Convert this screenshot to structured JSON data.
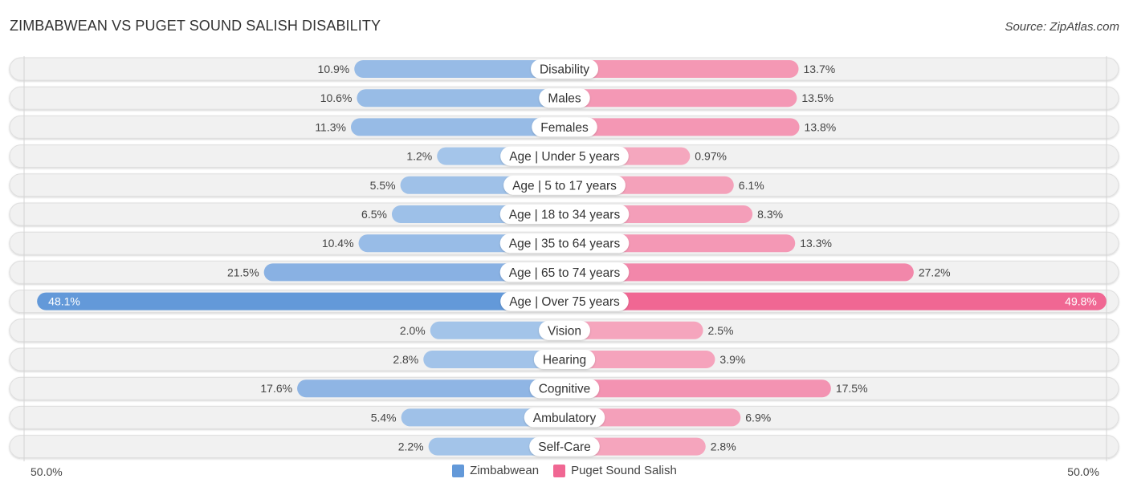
{
  "header": {
    "title": "ZIMBABWEAN VS PUGET SOUND SALISH DISABILITY",
    "source": "Source: ZipAtlas.com"
  },
  "colors": {
    "left_light": "#a6c6ea",
    "left_strong": "#6399d9",
    "right_light": "#f5a8bf",
    "right_strong": "#f06793",
    "track": "#f1f1f1"
  },
  "axis": {
    "left_label": "50.0%",
    "right_label": "50.0%"
  },
  "legend": [
    {
      "label": "Zimbabwean",
      "color": "#6399d9"
    },
    {
      "label": "Puget Sound Salish",
      "color": "#f06793"
    }
  ],
  "chart_data": {
    "type": "bar",
    "orientation": "horizontal-diverging",
    "title": "ZIMBABWEAN VS PUGET SOUND SALISH DISABILITY",
    "xlim": [
      -50,
      50
    ],
    "x_tick_labels": [
      "50.0%",
      "50.0%"
    ],
    "legend_position": "bottom-center",
    "categories": [
      "Disability",
      "Males",
      "Females",
      "Age | Under 5 years",
      "Age | 5 to 17 years",
      "Age | 18 to 34 years",
      "Age | 35 to 64 years",
      "Age | 65 to 74 years",
      "Age | Over 75 years",
      "Vision",
      "Hearing",
      "Cognitive",
      "Ambulatory",
      "Self-Care"
    ],
    "series": [
      {
        "name": "Zimbabwean",
        "side": "left",
        "values": [
          10.9,
          10.6,
          11.3,
          1.2,
          5.5,
          6.5,
          10.4,
          21.5,
          48.1,
          2.0,
          2.8,
          17.6,
          5.4,
          2.2
        ],
        "labels": [
          "10.9%",
          "10.6%",
          "11.3%",
          "1.2%",
          "5.5%",
          "6.5%",
          "10.4%",
          "21.5%",
          "48.1%",
          "2.0%",
          "2.8%",
          "17.6%",
          "5.4%",
          "2.2%"
        ]
      },
      {
        "name": "Puget Sound Salish",
        "side": "right",
        "values": [
          13.7,
          13.5,
          13.8,
          0.97,
          6.1,
          8.3,
          13.3,
          27.2,
          49.8,
          2.5,
          3.9,
          17.5,
          6.9,
          2.8
        ],
        "labels": [
          "13.7%",
          "13.5%",
          "13.8%",
          "0.97%",
          "6.1%",
          "8.3%",
          "13.3%",
          "27.2%",
          "49.8%",
          "2.5%",
          "3.9%",
          "17.5%",
          "6.9%",
          "2.8%"
        ]
      }
    ]
  }
}
